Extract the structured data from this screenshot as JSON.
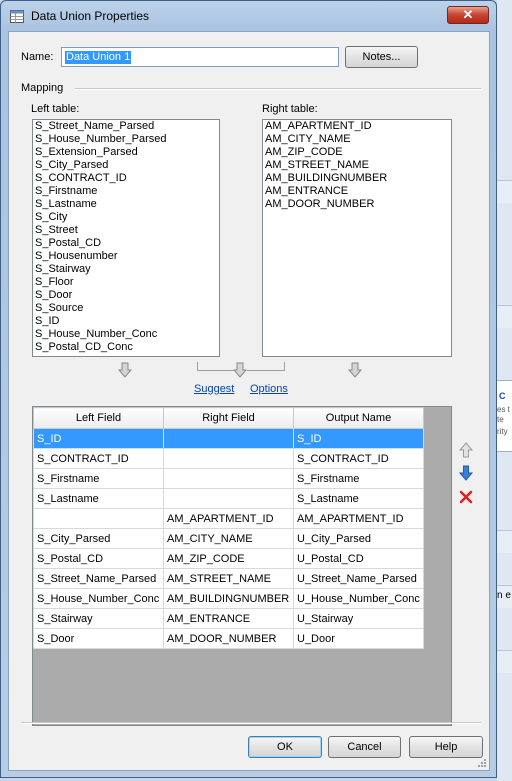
{
  "window": {
    "title": "Data Union Properties",
    "close_symbol": "✕"
  },
  "name_field": {
    "label": "Name:",
    "value": "Data Union 1"
  },
  "notes_button": {
    "label": "Notes..."
  },
  "mapping": {
    "label": "Mapping"
  },
  "left_table": {
    "label": "Left table:",
    "items": [
      "S_Street_Name_Parsed",
      "S_House_Number_Parsed",
      "S_Extension_Parsed",
      "S_City_Parsed",
      "S_CONTRACT_ID",
      "S_Firstname",
      "S_Lastname",
      "S_City",
      "S_Street",
      "S_Postal_CD",
      "S_Housenumber",
      "S_Stairway",
      "S_Floor",
      "S_Door",
      "S_Source",
      "S_ID",
      "S_House_Number_Conc",
      "S_Postal_CD_Conc"
    ]
  },
  "right_table": {
    "label": "Right table:",
    "items": [
      "AM_APARTMENT_ID",
      "AM_CITY_NAME",
      "AM_ZIP_CODE",
      "AM_STREET_NAME",
      "AM_BUILDINGNUMBER",
      "AM_ENTRANCE",
      "AM_DOOR_NUMBER"
    ]
  },
  "links": {
    "suggest": "Suggest",
    "options": "Options"
  },
  "grid": {
    "columns": [
      "Left Field",
      "Right Field",
      "Output Name"
    ],
    "rows": [
      [
        "S_ID",
        "",
        "S_ID"
      ],
      [
        "S_CONTRACT_ID",
        "",
        "S_CONTRACT_ID"
      ],
      [
        "S_Firstname",
        "",
        "S_Firstname"
      ],
      [
        "S_Lastname",
        "",
        "S_Lastname"
      ],
      [
        "",
        "AM_APARTMENT_ID",
        "AM_APARTMENT_ID"
      ],
      [
        "S_City_Parsed",
        "AM_CITY_NAME",
        "U_City_Parsed"
      ],
      [
        "S_Postal_CD",
        "AM_ZIP_CODE",
        "U_Postal_CD"
      ],
      [
        "S_Street_Name_Parsed",
        "AM_STREET_NAME",
        "U_Street_Name_Parsed"
      ],
      [
        "S_House_Number_Conc",
        "AM_BUILDINGNUMBER",
        "U_House_Number_Conc"
      ],
      [
        "S_Stairway",
        "AM_ENTRANCE",
        "U_Stairway"
      ],
      [
        "S_Door",
        "AM_DOOR_NUMBER",
        "U_Door"
      ]
    ],
    "selected_row": 0
  },
  "side_icons": [
    "move-up-icon",
    "move-down-icon",
    "delete-icon"
  ],
  "buttons": {
    "ok": "OK",
    "cancel": "Cancel",
    "help": "Help"
  },
  "background": {
    "panel_title": "C",
    "panel_lines": [
      "es t",
      "te",
      "rity"
    ],
    "bottom_text": "n e"
  },
  "colors": {
    "selection": "#3399ff",
    "link": "#0645ad",
    "delete": "#e02020",
    "arrow_blue": "#3b7fd6"
  }
}
